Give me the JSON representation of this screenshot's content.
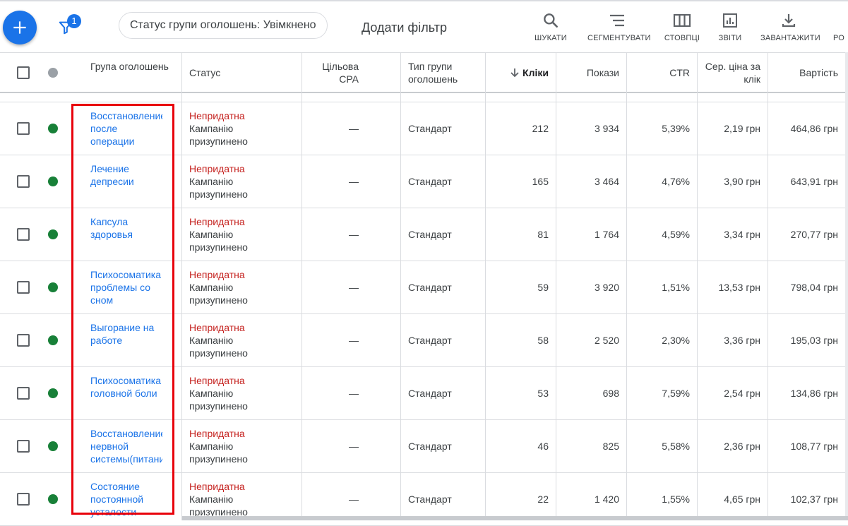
{
  "toolbar": {
    "add_icon": "plus-icon",
    "filter_icon": "funnel-icon",
    "filter_count": "1",
    "chip_label": "Статус групи оголошень: Увімкнено",
    "add_filter": "Додати фільтр",
    "tools": [
      {
        "label": "ШУКАТИ",
        "icon": "search-icon"
      },
      {
        "label": "СЕГМЕНТУВАТИ",
        "icon": "segment-icon"
      },
      {
        "label": "СТОВПЦІ",
        "icon": "columns-icon"
      },
      {
        "label": "ЗВІТИ",
        "icon": "reports-icon"
      },
      {
        "label": "ЗАВАНТАЖИТИ",
        "icon": "download-icon"
      },
      {
        "label": "РО",
        "icon": "expand-icon"
      }
    ]
  },
  "table": {
    "headers": {
      "ad_group": "Група оголошень",
      "status": "Статус",
      "target_cpa": "Цільова CPA",
      "ad_group_type": "Тип групи оголошень",
      "clicks": "Кліки",
      "impressions": "Покази",
      "ctr": "CTR",
      "avg_cpc": "Сер. ціна за клік",
      "cost": "Вартість"
    },
    "sort_icon": "arrow-down-icon",
    "rows": [
      {
        "name": "Восстановление после операции",
        "status_main": "Непридатна",
        "status_sub": "Кампанію призупинено",
        "target_cpa": "—",
        "type": "Стандарт",
        "clicks": "212",
        "impressions": "3 934",
        "ctr": "5,39%",
        "avg_cpc": "2,19 грн",
        "cost": "464,86 грн"
      },
      {
        "name": "Лечение депресии",
        "status_main": "Непридатна",
        "status_sub": "Кампанію призупинено",
        "target_cpa": "—",
        "type": "Стандарт",
        "clicks": "165",
        "impressions": "3 464",
        "ctr": "4,76%",
        "avg_cpc": "3,90 грн",
        "cost": "643,91 грн"
      },
      {
        "name": "Капсула здоровья",
        "status_main": "Непридатна",
        "status_sub": "Кампанію призупинено",
        "target_cpa": "—",
        "type": "Стандарт",
        "clicks": "81",
        "impressions": "1 764",
        "ctr": "4,59%",
        "avg_cpc": "3,34 грн",
        "cost": "270,77 грн"
      },
      {
        "name": "Психосоматика проблемы со сном",
        "status_main": "Непридатна",
        "status_sub": "Кампанію призупинено",
        "target_cpa": "—",
        "type": "Стандарт",
        "clicks": "59",
        "impressions": "3 920",
        "ctr": "1,51%",
        "avg_cpc": "13,53 грн",
        "cost": "798,04 грн"
      },
      {
        "name": "Выгорание на работе",
        "status_main": "Непридатна",
        "status_sub": "Кампанію призупинено",
        "target_cpa": "—",
        "type": "Стандарт",
        "clicks": "58",
        "impressions": "2 520",
        "ctr": "2,30%",
        "avg_cpc": "3,36 грн",
        "cost": "195,03 грн"
      },
      {
        "name": "Психосоматика головной боли",
        "status_main": "Непридатна",
        "status_sub": "Кампанію призупинено",
        "target_cpa": "—",
        "type": "Стандарт",
        "clicks": "53",
        "impressions": "698",
        "ctr": "7,59%",
        "avg_cpc": "2,54 грн",
        "cost": "134,86 грн"
      },
      {
        "name": "Восстановление нервной системы(питание)",
        "status_main": "Непридатна",
        "status_sub": "Кампанію призупинено",
        "target_cpa": "—",
        "type": "Стандарт",
        "clicks": "46",
        "impressions": "825",
        "ctr": "5,58%",
        "avg_cpc": "2,36 грн",
        "cost": "108,77 грн"
      },
      {
        "name": "Состояние постоянной усталости",
        "status_main": "Непридатна",
        "status_sub": "Кампанію призупинено",
        "target_cpa": "—",
        "type": "Стандарт",
        "clicks": "22",
        "impressions": "1 420",
        "ctr": "1,55%",
        "avg_cpc": "4,65 грн",
        "cost": "102,37 грн"
      }
    ]
  },
  "colors": {
    "accent": "#1a73e8",
    "link": "#1a73e8",
    "status_ineligible": "#c5221f",
    "enabled_dot": "#188038",
    "highlight_box": "#e8000b"
  }
}
